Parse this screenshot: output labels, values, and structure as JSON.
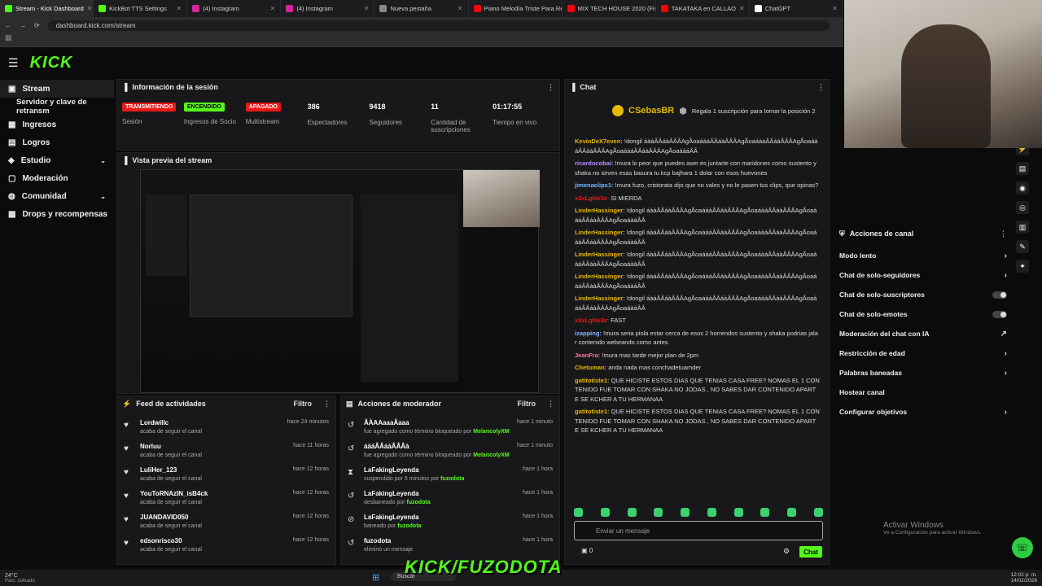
{
  "browser": {
    "tabs": [
      {
        "label": "Stream - Kick Dashboard",
        "color": "#53fc18"
      },
      {
        "label": "KickBot TTS Settings",
        "color": "#53fc18"
      },
      {
        "label": "(4) Instagram",
        "color": "#d6249f"
      },
      {
        "label": "(4) Instagram",
        "color": "#d6249f"
      },
      {
        "label": "Nueva pestaña",
        "color": "#888888"
      },
      {
        "label": "Piano Melodía Triste Para Reco",
        "color": "#ff0000"
      },
      {
        "label": "MIX TECH HOUSE 2020 (Fishe",
        "color": "#ff0000"
      },
      {
        "label": "TAKATAKA en CALLAO",
        "color": "#ff0000"
      },
      {
        "label": "ChatGPT",
        "color": "#ffffff"
      }
    ],
    "url": "dashboard.kick.com/stream"
  },
  "brand": {
    "logo": "KICK",
    "accent": "#53fc18"
  },
  "sidebar": {
    "items": [
      {
        "label": "Stream",
        "icon": "video-icon"
      },
      {
        "label": "Servidor y clave de retransm"
      },
      {
        "label": "Ingresos",
        "icon": "cash-icon"
      },
      {
        "label": "Logros",
        "icon": "trophy-icon"
      },
      {
        "label": "Estudio",
        "icon": "studio-icon"
      },
      {
        "label": "Moderación",
        "icon": "shield-icon"
      },
      {
        "label": "Comunidad",
        "icon": "people-icon"
      },
      {
        "label": "Drops y recompensas",
        "icon": "gift-icon"
      }
    ]
  },
  "session": {
    "title": "Información de la sesión",
    "stats": [
      {
        "badge": "TRANSMITIENDO",
        "badge_color": "#e91916",
        "label": "Sesión"
      },
      {
        "badge": "ENCENDIDO",
        "badge_color": "#53fc18",
        "label": "Ingresos de Socio"
      },
      {
        "badge": "APAGADO",
        "badge_color": "#e91916",
        "label": "Multistream"
      },
      {
        "value": "386",
        "label": "Espectadores"
      },
      {
        "value": "9418",
        "label": "Seguidores"
      },
      {
        "value": "11",
        "label": "Cantidad de suscripciones"
      },
      {
        "value": "01:17:55",
        "label": "Tiempo en vivo"
      }
    ]
  },
  "preview": {
    "title": "Vista previa del stream"
  },
  "feed": {
    "title": "Feed de actividades",
    "filter": "Filtro",
    "items": [
      {
        "name": "Lordwillc",
        "sub": "acaba de seguir el canal",
        "time": "hace 24 minutos"
      },
      {
        "name": "Norluu",
        "sub": "acaba de seguir el canal",
        "time": "hace 11 horas"
      },
      {
        "name": "LuliHer_123",
        "sub": "acaba de seguir el canal",
        "time": "hace 12 horas"
      },
      {
        "name": "YouToRNAzIN_isB4ck",
        "sub": "acaba de seguir el canal",
        "time": "hace 12 horas"
      },
      {
        "name": "JUANDAVID050",
        "sub": "acaba de seguir el canal",
        "time": "hace 12 horas"
      },
      {
        "name": "edsonrisco30",
        "sub": "acaba de seguir el canal",
        "time": "hace 12 horas"
      }
    ]
  },
  "modactions": {
    "title": "Acciones de moderador",
    "filter": "Filtro",
    "items": [
      {
        "name": "ÂÀAAaaaÂaaa",
        "sub": "fue agregado como término bloqueado por",
        "by": "MelancolyXM",
        "time": "hace 1 minuto"
      },
      {
        "name": "áàáÂÂáàÂÂÂà",
        "sub": "fue agregado como término bloqueado por",
        "by": "MelancolyXM",
        "time": "hace 1 minuto"
      },
      {
        "name": "LaFakingLeyenda",
        "sub": "suspendido por 5 minutos por",
        "by": "fuzodota",
        "time": "hace 1 hora"
      },
      {
        "name": "LaFakingLeyenda",
        "sub": "desbaneado por",
        "by": "fuzodota",
        "time": "hace 1 hora"
      },
      {
        "name": "LaFakingLeyenda",
        "sub": "baneado por",
        "by": "fuzodota",
        "time": "hace 1 hora"
      },
      {
        "name": "fuzodota",
        "sub": "eliminó un mensaje",
        "by": "",
        "time": "hace 1 hora"
      }
    ]
  },
  "chat": {
    "title": "Chat",
    "pinned_user": "CSebasBR",
    "pinned_text": "Regala 1 suscripción para tomar la posición 2",
    "messages": [
      {
        "user": "KevinDeX7even:",
        "color": "#e6b800",
        "text": "!dongil áàáÂÂáàÂÂÂAgÃoaáàáÂÂáàÂÂÂAgÃoaáàáÂÂáàÂÂÂAgÃoaáàáÂÂáàÂÂÂAgÃoaáàáÂÂáàÂÂÂAgÃoaáàáÂÂ"
      },
      {
        "user": "ricardocobai:",
        "color": "#b58cff",
        "text": "!mura lo peor que puedes aser es juntarte con maridones como sustento y shaka no sirven esas basura tu kcp bajhara 1 dolar con esos huevones"
      },
      {
        "user": "jimenaclips1:",
        "color": "#7ab8ff",
        "text": "!mura fuzo, cristorata dijo que no vales y no le pasen tus clips, que opinas?"
      },
      {
        "user": "x3xLgNx3x:",
        "color": "#e91916",
        "text": "SI MIERDA"
      },
      {
        "user": "LinderHassinger:",
        "color": "#e6b800",
        "text": "!dongil áàáÂÂáàÂÂÂAgÃoaáàáÂÂáàÂÂÂAgÃoaáàáÂÂáàÂÂÂAgÃoaáàáÂÂáàÂÂÂAgÃoaáàáÂÂ"
      },
      {
        "user": "LinderHassinger:",
        "color": "#e6b800",
        "text": "!dongil áàáÂÂáàÂÂÂAgÃoaáàáÂÂáàÂÂÂAgÃoaáàáÂÂáàÂÂÂAgÃoaáàáÂÂáàÂÂÂAgÃoaáàáÂÂ"
      },
      {
        "user": "LinderHassinger:",
        "color": "#e6b800",
        "text": "!dongil áàáÂÂáàÂÂÂAgÃoaáàáÂÂáàÂÂÂAgÃoaáàáÂÂáàÂÂÂAgÃoaáàáÂÂáàÂÂÂAgÃoaáàáÂÂ"
      },
      {
        "user": "LinderHassinger:",
        "color": "#e6b800",
        "text": "!dongil áàáÂÂáàÂÂÂAgÃoaáàáÂÂáàÂÂÂAgÃoaáàáÂÂáàÂÂÂAgÃoaáàáÂÂáàÂÂÂAgÃoaáàáÂÂ"
      },
      {
        "user": "LinderHassinger:",
        "color": "#e6b800",
        "text": "!dongil áàáÂÂáàÂÂÂAgÃoaáàáÂÂáàÂÂÂAgÃoaáàáÂÂáàÂÂÂAgÃoaáàáÂÂáàÂÂÂAgÃoaáàáÂÂ"
      },
      {
        "user": "x3xLgNx3x:",
        "color": "#e91916",
        "text": "FAST"
      },
      {
        "user": "izapping:",
        "color": "#7ab8ff",
        "text": "!mura seria piola estar cerca de esos 2 horrendos sustento y shaka podrias jalar contenido webeando como antes"
      },
      {
        "user": "JeanFra:",
        "color": "#ff7a9c",
        "text": "!mura mas tarde mejor plan de 2pm"
      },
      {
        "user": "Chetuman:",
        "color": "#e6b800",
        "text": "anda nada mas conchadetuamder"
      },
      {
        "user": "gatitotiste1:",
        "color": "#e6b800",
        "text": "QUE HICISTE ESTOS DIAS QUE TENIAS CASA FREE? NOMAS EL 1 CONTENIDO FUE TOMAR CON SHAKA NO JODAS , NO SABES DAR CONTENIDO APARTE SE KCHER A TU HERMANAA"
      },
      {
        "user": "gatitotiste1:",
        "color": "#e6b800",
        "text": "QUE HICISTE ESTOS DIAS QUE TENIAS CASA FREE? NOMAS EL 1 CONTENIDO FUE TOMAR CON SHAKA NO JODAS , NO SABES DAR CONTENIDO APARTE SE KCHER A TU HERMANAA"
      }
    ],
    "input_placeholder": "Enviar un mensaje",
    "count": "0",
    "send_label": "Chat"
  },
  "actions": {
    "title": "Acciones de canal",
    "items": [
      {
        "label": "Modo lento",
        "kind": "chevron"
      },
      {
        "label": "Chat de solo-seguidores",
        "kind": "chevron"
      },
      {
        "label": "Chat de solo-suscriptores",
        "kind": "toggle"
      },
      {
        "label": "Chat de solo-emotes",
        "kind": "toggle"
      },
      {
        "label": "Moderación del chat con IA",
        "kind": "external"
      },
      {
        "label": "Restricción de edad",
        "kind": "chevron"
      },
      {
        "label": "Palabras baneadas",
        "kind": "chevron"
      },
      {
        "label": "Hostear canal",
        "kind": "none"
      },
      {
        "label": "Configurar objetivos",
        "kind": "chevron"
      }
    ]
  },
  "windows": {
    "activate_title": "Activar Windows",
    "activate_sub": "Ve a Configuración para activar Windows.",
    "weather": "24°C",
    "weather_sub": "Parc. soleado",
    "search": "Buscar",
    "time": "12:02 p. m.",
    "date": "14/02/2026"
  },
  "overlay_text": "KICK/FUZODOTA"
}
